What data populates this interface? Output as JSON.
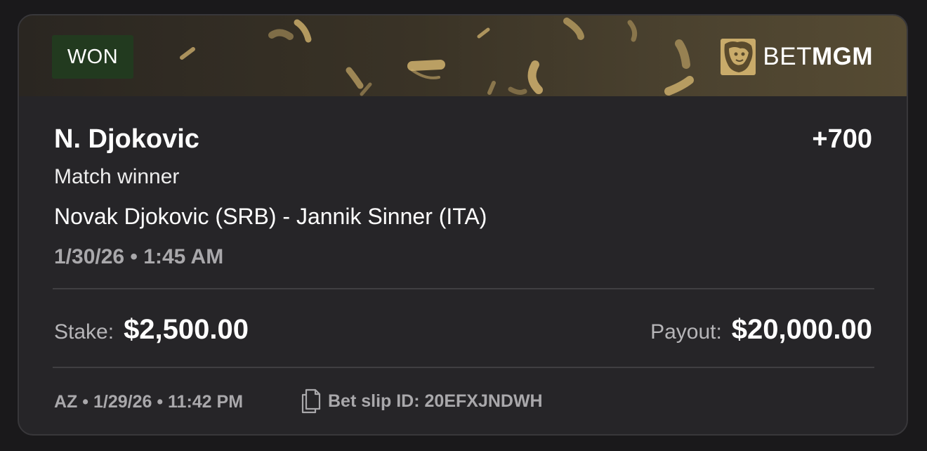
{
  "status": {
    "label": "WON",
    "color": "#223a1f"
  },
  "brand": {
    "light": "BET",
    "bold": "MGM",
    "accent": "#c9ab6a"
  },
  "bet": {
    "selection": "N. Djokovic",
    "odds": "+700",
    "market": "Match winner",
    "event": "Novak Djokovic (SRB) - Jannik Sinner (ITA)",
    "event_time": "1/30/26 • 1:45 AM"
  },
  "stake": {
    "label": "Stake:",
    "value": "$2,500.00"
  },
  "payout": {
    "label": "Payout:",
    "value": "$20,000.00"
  },
  "footer": {
    "placed": "AZ • 1/29/26 • 11:42 PM",
    "slip_id": "Bet slip ID: 20EFXJNDWH"
  }
}
